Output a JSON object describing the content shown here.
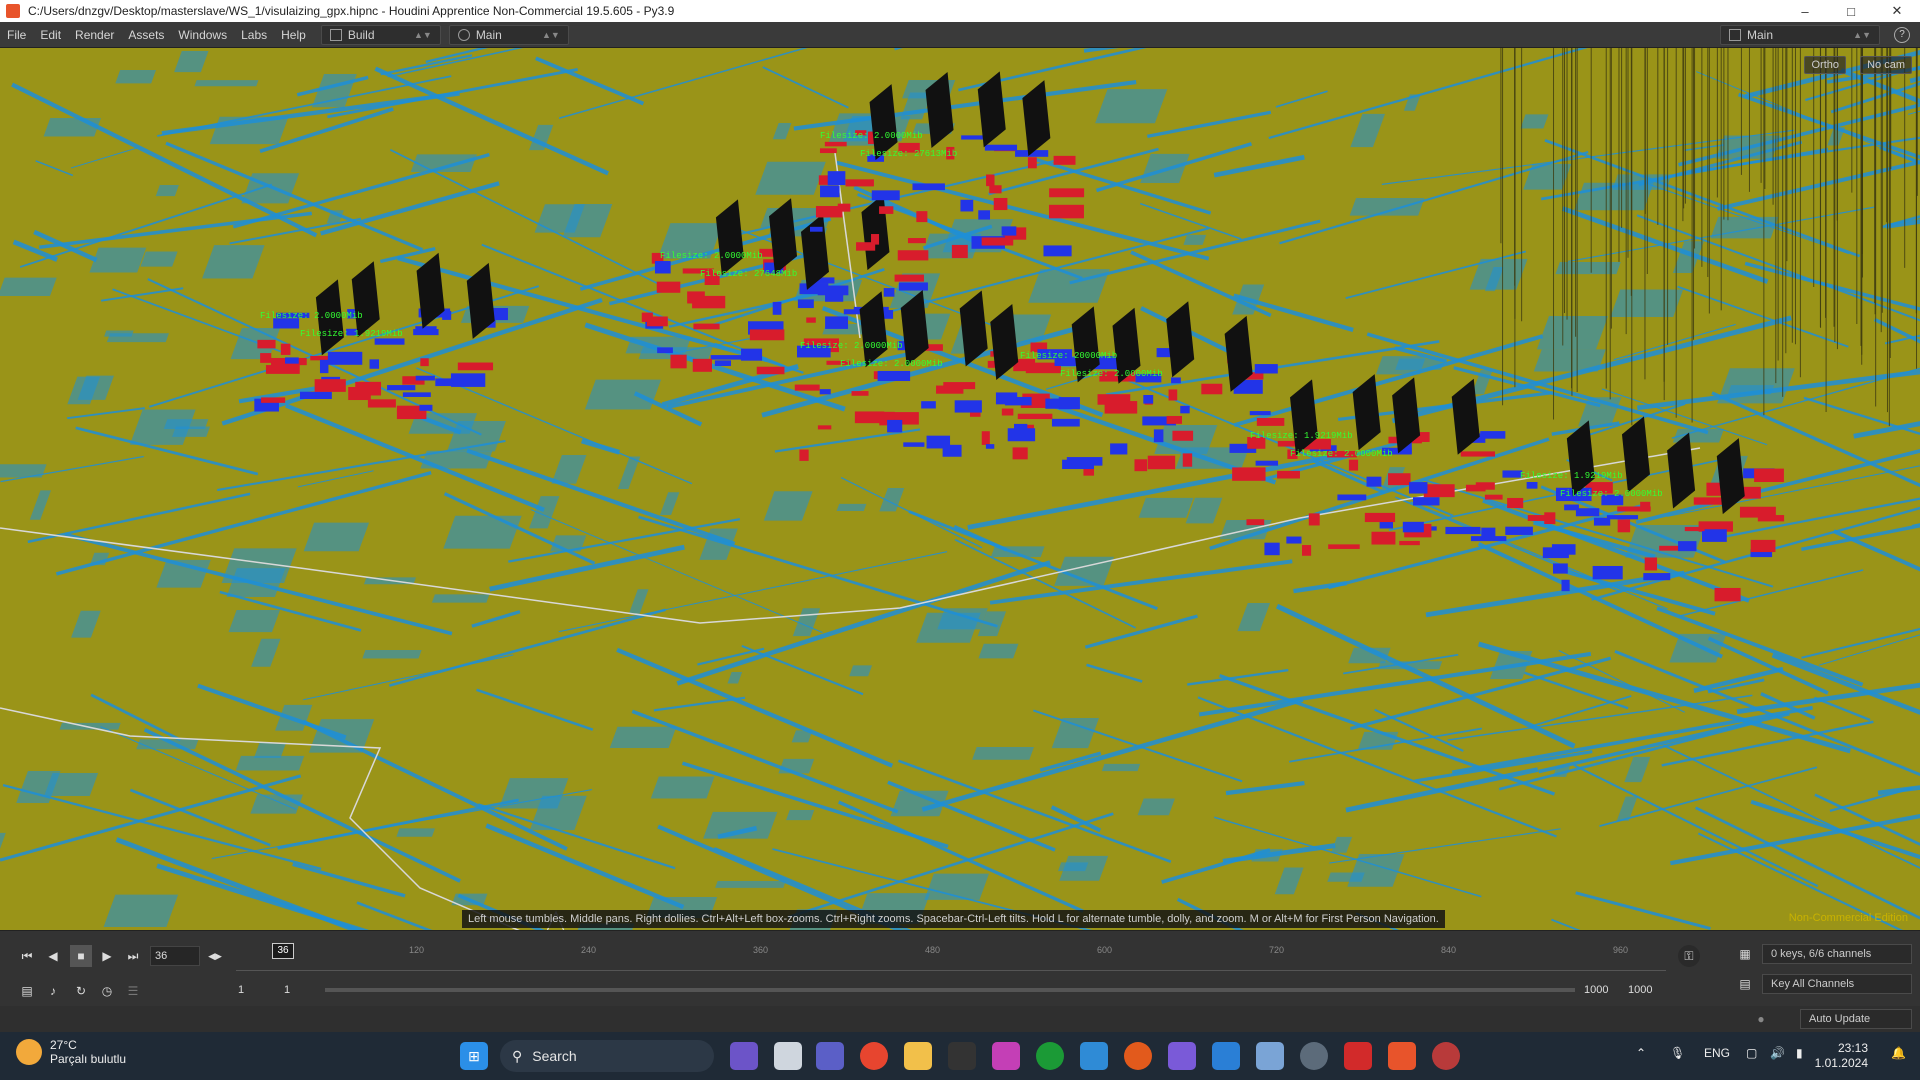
{
  "window": {
    "title": "C:/Users/dnzgv/Desktop/masterslave/WS_1/visulaizing_gpx.hipnc - Houdini Apprentice Non-Commercial 19.5.605 - Py3.9",
    "minimize_icon": "minimize-icon",
    "maximize_icon": "maximize-icon",
    "close_icon": "close-icon"
  },
  "menubar": {
    "items": [
      "File",
      "Edit",
      "Render",
      "Assets",
      "Windows",
      "Labs",
      "Help"
    ],
    "desktop_build": "Build",
    "desktop_main": "Main",
    "right_desktop": "Main"
  },
  "viewport": {
    "camera_ortho": "Ortho",
    "camera_nocam": "No cam",
    "hint": "Left mouse tumbles. Middle pans. Right dollies. Ctrl+Alt+Left box-zooms. Ctrl+Right zooms. Spacebar-Ctrl-Left tilts. Hold L for alternate tumble, dolly, and zoom.     M or Alt+M for First Person Navigation.",
    "watermark": "Non-Commercial Edition",
    "labels": [
      "Filesize: 2.0000Mib",
      "Filesize: 1.9219Mib",
      "Filesize: 2.0000Mib",
      "Filesize: 27648Mib",
      "Filesize: 2.0000Mib",
      "Filesize: 27613Mib",
      "Filesize: 2.0000Mib",
      "Filesize: 2.0000Mib",
      "Filesize: 20000Mib",
      "Filesize: 2.0000Mib",
      "Filesize: 1.9219Mib",
      "Filesize: 2.0000Mib",
      "Filesize: 1.9219Mib",
      "Filesize: 2.0000Mib"
    ],
    "colors": {
      "ground": "#9a9418",
      "wire": "#1e8fd8",
      "label": "#33ff33",
      "bar_red": "#d81c2c",
      "bar_blue": "#2234e8"
    }
  },
  "timeline": {
    "current_frame": "36",
    "frame_field": "36",
    "tick_labels": [
      "120",
      "240",
      "360",
      "480",
      "600",
      "720",
      "840",
      "960"
    ],
    "range_start": "1",
    "range_start2": "1",
    "range_end": "1000",
    "range_end2": "1000",
    "keys_channels": "0 keys, 6/6 channels",
    "key_all": "Key All Channels",
    "auto_update": "Auto Update"
  },
  "taskbar": {
    "temperature": "27°C",
    "weather_text": "Parçalı bulutlu",
    "search_placeholder": "Search",
    "language": "ENG",
    "time": "23:13",
    "date": "1.01.2024"
  }
}
